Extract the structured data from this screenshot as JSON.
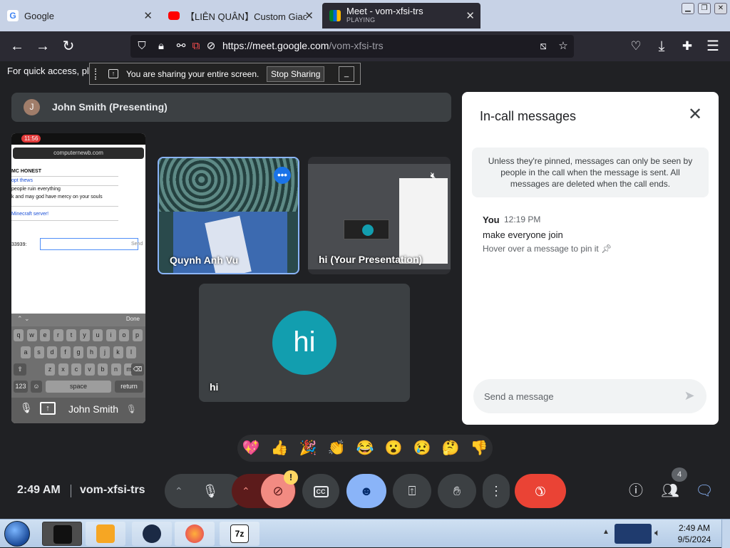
{
  "browser": {
    "tabs": [
      {
        "title": "Google",
        "favicon": "google-icon",
        "active": false
      },
      {
        "title": "【LIÊN QUÂN】Custom Giao H",
        "favicon": "youtube-icon",
        "active": false
      },
      {
        "title": "Meet - vom-xfsi-trs",
        "subtitle": "PLAYING",
        "favicon": "meet-icon",
        "active": true
      }
    ],
    "window_buttons": [
      "minimize",
      "restore",
      "close"
    ],
    "url": {
      "host": "https://meet.google.com",
      "path": "/vom-xfsi-trs"
    },
    "bookmark_hint": "For quick access, plac",
    "share_bar": {
      "text": "You are sharing your entire screen.",
      "stop_label": "Stop Sharing",
      "hide_label": "_"
    }
  },
  "meet": {
    "presenting_banner": {
      "avatar_letter": "J",
      "name": "John Smith (Presenting)"
    },
    "presentation": {
      "status_time": "11:56",
      "address": "computernewb.com",
      "lines": [
        "MC HONEST",
        "opt thews",
        "people ruin everything",
        "k and may god have mercy on your souls",
        "Minecraft server!"
      ],
      "input_prefix": "33939:",
      "send_label": "Send",
      "keyboard_done": "Done",
      "keyboard_rows": [
        [
          "q",
          "w",
          "e",
          "r",
          "t",
          "y",
          "u",
          "i",
          "o",
          "p"
        ],
        [
          "a",
          "s",
          "d",
          "f",
          "g",
          "h",
          "j",
          "k",
          "l"
        ],
        [
          "z",
          "x",
          "c",
          "v",
          "b",
          "n",
          "m"
        ]
      ],
      "kb_123": "123",
      "kb_space": "space",
      "kb_return": "return",
      "presenter_name": "John Smith"
    },
    "tiles": [
      {
        "name": "Quynh Anh Vu"
      },
      {
        "name": "hi (Your Presentation)"
      },
      {
        "name": "hi",
        "avatar": "hi"
      }
    ],
    "chat": {
      "title": "In-call messages",
      "info": "Unless they're pinned, messages can only be seen by people in the call when the message is sent. All messages are deleted when the call ends.",
      "messages": [
        {
          "sender": "You",
          "time": "12:19 PM",
          "text": "make everyone join",
          "hint": "Hover over a message to pin it"
        }
      ],
      "input_placeholder": "Send a message"
    },
    "reactions": [
      "💖",
      "👍",
      "🎉",
      "👏",
      "😂",
      "😮",
      "😢",
      "🤔",
      "👎"
    ],
    "controls": {
      "time": "2:49 AM",
      "meeting_code": "vom-xfsi-trs",
      "warning_badge": "!",
      "participants_count": "4",
      "cc_label": "CC"
    },
    "colors": {
      "accent": "#8ab4f8",
      "end_call": "#ea4335",
      "camera_off": "#f28b82",
      "emoji_active": "#8ab4f8",
      "avatar_teal": "#129eaf"
    }
  },
  "taskbar": {
    "apps": [
      "cmd",
      "media-player",
      "dark-orb",
      "firefox",
      "7zip"
    ],
    "tray_time": "2:49 AM",
    "tray_date": "9/5/2024"
  }
}
